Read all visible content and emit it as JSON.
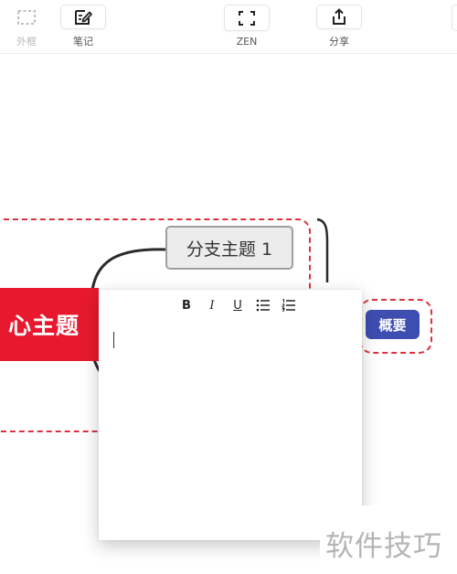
{
  "toolbar": {
    "boundary_label": "外框",
    "note_label": "笔记",
    "zen_label": "ZEN",
    "share_label": "分享"
  },
  "mindmap": {
    "central_topic": "心主题",
    "branch_topic": "分支主题 1",
    "summary_topic": "概要",
    "colors": {
      "central": "#e8192f",
      "summary": "#3e4db0",
      "boundary": "#d9343e",
      "branch_border": "#9e9e9e"
    }
  },
  "note_editor": {
    "format_buttons": [
      "B",
      "I",
      "U"
    ]
  },
  "watermark": "软件技巧"
}
